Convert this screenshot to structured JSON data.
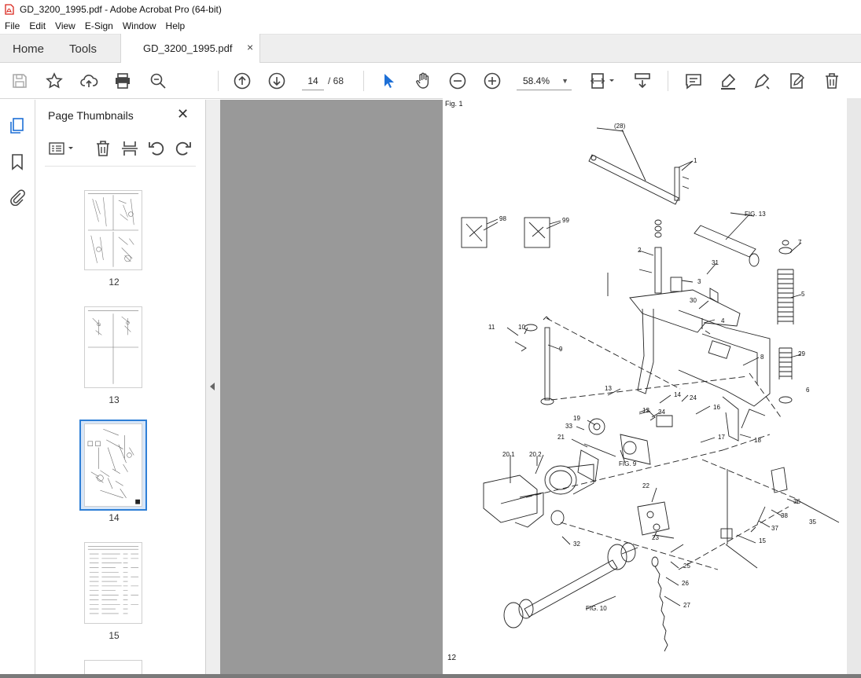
{
  "window": {
    "title": "GD_3200_1995.pdf - Adobe Acrobat Pro (64-bit)"
  },
  "menu": [
    "File",
    "Edit",
    "View",
    "E-Sign",
    "Window",
    "Help"
  ],
  "tabs": {
    "home": "Home",
    "tools": "Tools",
    "document": "GD_3200_1995.pdf",
    "close": "×"
  },
  "toolbar": {
    "current_page": "14",
    "page_of": "/  68",
    "zoom": "58.4%"
  },
  "panel": {
    "title": "Page Thumbnails",
    "close": "✕",
    "thumbnails": [
      {
        "label": "12",
        "selected": false
      },
      {
        "label": "13",
        "selected": false
      },
      {
        "label": "14",
        "selected": true
      },
      {
        "label": "15",
        "selected": false
      }
    ]
  },
  "document": {
    "fig_label": "Fig. 1",
    "page_number": "12",
    "callouts": [
      "(28)",
      "1",
      "FIG. 13",
      "98",
      "99",
      "7",
      "2",
      "31",
      "3",
      "30",
      "5",
      "4",
      "11",
      "10",
      "9",
      "8",
      "29",
      "13",
      "14",
      "24",
      "6",
      "12",
      "34",
      "16",
      "19",
      "33",
      "17",
      "18",
      "21",
      "FIG. 9",
      "20.1",
      "20.2",
      "36",
      "22",
      "38",
      "35",
      "37",
      "23",
      "15",
      "32",
      "25",
      "26",
      "FIG. 10",
      "27"
    ]
  },
  "colors": {
    "accent": "#2e7fd6",
    "doc_background": "#999999",
    "pdf_icon": "#d9261c"
  }
}
